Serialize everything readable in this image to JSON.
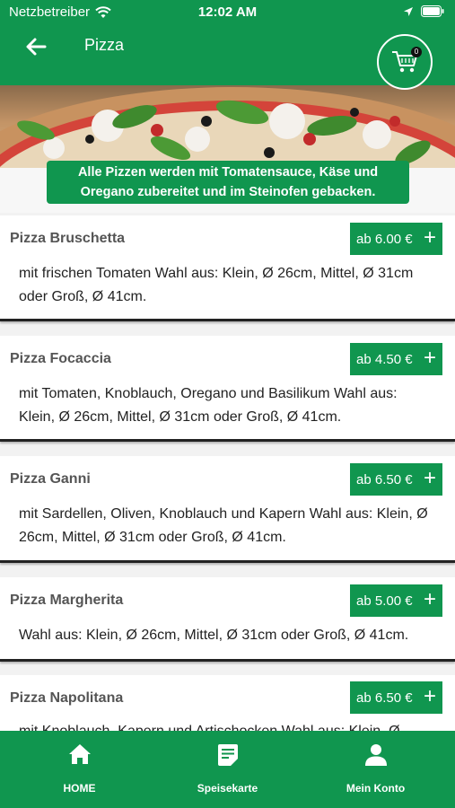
{
  "status_bar": {
    "carrier": "Netzbetreiber",
    "time": "12:02 AM"
  },
  "header": {
    "title": "Pizza",
    "cart_count": "0"
  },
  "notice": {
    "line1": "Alle Pizzen werden mit Tomatensauce, Käse und",
    "line2": "Oregano zubereitet und im Steinofen gebacken."
  },
  "items": [
    {
      "name": "Pizza Bruschetta",
      "price": "ab 6.00 €",
      "desc_line1": "mit frischen Tomaten Wahl aus: Klein, Ø 26cm, Mittel, Ø 31cm",
      "desc_line2": "oder Groß, Ø 41cm."
    },
    {
      "name": "Pizza Focaccia",
      "price": "ab 4.50 €",
      "desc_line1": "mit Tomaten, Knoblauch, Oregano und Basilikum Wahl aus:",
      "desc_line2": "Klein, Ø 26cm, Mittel, Ø 31cm oder Groß, Ø 41cm."
    },
    {
      "name": "Pizza Ganni",
      "price": "ab 6.50 €",
      "desc_line1": "mit Sardellen, Oliven, Knoblauch und Kapern Wahl aus: Klein, Ø",
      "desc_line2": "26cm, Mittel, Ø 31cm oder Groß, Ø 41cm."
    },
    {
      "name": "Pizza Margherita",
      "price": "ab 5.00 €",
      "desc_line1": "Wahl aus: Klein, Ø 26cm, Mittel, Ø 31cm oder Groß, Ø 41cm.",
      "desc_line2": ""
    },
    {
      "name": "Pizza Napolitana",
      "price": "ab 6.50 €",
      "desc_line1": "mit Knoblauch, Kapern und Artischocken Wahl aus: Klein, Ø",
      "desc_line2": ""
    }
  ],
  "bottom_nav": {
    "home": "HOME",
    "menu": "Speisekarte",
    "account": "Mein Konto"
  },
  "colors": {
    "brand_green": "#10964f"
  },
  "icons": [
    "wifi-icon",
    "location-arrow-icon",
    "battery-icon",
    "back-arrow-icon",
    "cart-icon",
    "plus-icon",
    "home-icon",
    "menu-list-icon",
    "user-icon"
  ]
}
